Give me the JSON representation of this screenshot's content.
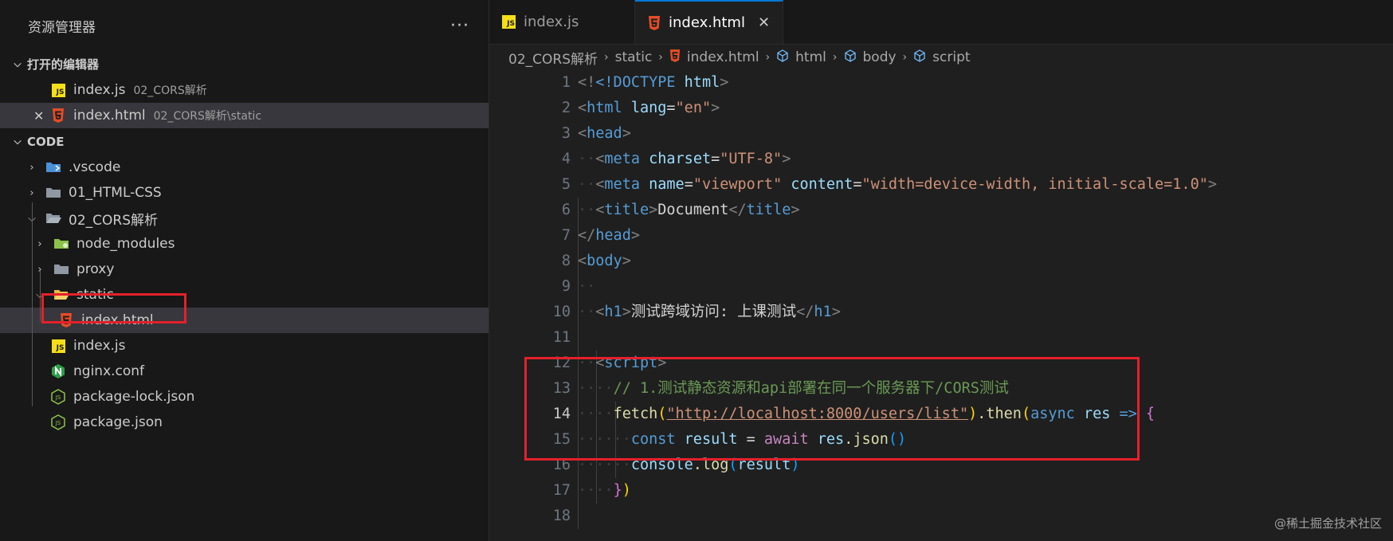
{
  "sidebar": {
    "title": "资源管理器",
    "more_icon": "more-actions-icon",
    "open_editors": {
      "label": "打开的编辑器",
      "items": [
        {
          "name": "index.js",
          "description": "02_CORS解析",
          "icon": "javascript-file-icon"
        },
        {
          "name": "index.html",
          "description": "02_CORS解析\\static",
          "icon": "html-file-icon",
          "close_label": "✕"
        }
      ]
    },
    "workspace": {
      "label": "CODE",
      "items": [
        {
          "name": ".vscode"
        },
        {
          "name": "01_HTML-CSS"
        },
        {
          "name": "02_CORS解析"
        },
        {
          "name": "node_modules"
        },
        {
          "name": "proxy"
        },
        {
          "name": "static"
        },
        {
          "name": "index.html"
        },
        {
          "name": "index.js"
        },
        {
          "name": "nginx.conf"
        },
        {
          "name": "package-lock.json"
        },
        {
          "name": "package.json"
        }
      ]
    }
  },
  "tabs": [
    {
      "label": "index.js",
      "icon": "javascript-file-icon",
      "active": false
    },
    {
      "label": "index.html",
      "icon": "html-file-icon",
      "active": true,
      "close": "✕"
    }
  ],
  "breadcrumb": {
    "items": [
      "02_CORS解析",
      "static",
      "index.html",
      "html",
      "body",
      "script"
    ],
    "separator": "›"
  },
  "editor": {
    "current_line": 14,
    "line_numbers": [
      "1",
      "2",
      "3",
      "4",
      "5",
      "6",
      "7",
      "8",
      "9",
      "10",
      "11",
      "12",
      "13",
      "14",
      "15",
      "16",
      "17",
      "18"
    ]
  },
  "code_text": {
    "l1_doctype": "<!DOCTYPE",
    "l1_html": "html",
    "l2_html": "html",
    "l2_lang": "lang",
    "l2_en": "\"en\"",
    "l3_head": "head",
    "l4_meta": "meta",
    "l4_charset": "charset",
    "l4_val": "\"UTF-8\"",
    "l5_meta": "meta",
    "l5_name": "name",
    "l5_nameval": "\"viewport\"",
    "l5_content": "content",
    "l5_contentval": "\"width=device-width, initial-scale=1.0\"",
    "l6_title": "title",
    "l6_text": "Document",
    "l6_titleclose": "title",
    "l7_head": "head",
    "l8_body": "body",
    "l10_h1": "h1",
    "l10_text": "测试跨域访问: 上课测试",
    "l10_h1close": "h1",
    "l12_script": "script",
    "l13_comment": "// 1.测试静态资源和api部署在同一个服务器下/CORS测试",
    "l14_fetch": "fetch",
    "l14_url": "\"http://localhost:8000/users/list\"",
    "l14_then": ".then",
    "l14_async": "async",
    "l14_res": "res",
    "l14_arrow": "=>",
    "l15_const": "const",
    "l15_result": "result",
    "l15_eq": "=",
    "l15_await": "await",
    "l15_res": "res",
    "l15_json": ".json",
    "l16_console": "console",
    "l16_log": ".log",
    "l16_result": "result"
  },
  "watermark": "@稀土掘金技术社区",
  "colors": {
    "accent": "#0078d4",
    "highlight_box": "#e5202a",
    "js_icon": "#f5de19",
    "html_icon": "#e44d26"
  }
}
